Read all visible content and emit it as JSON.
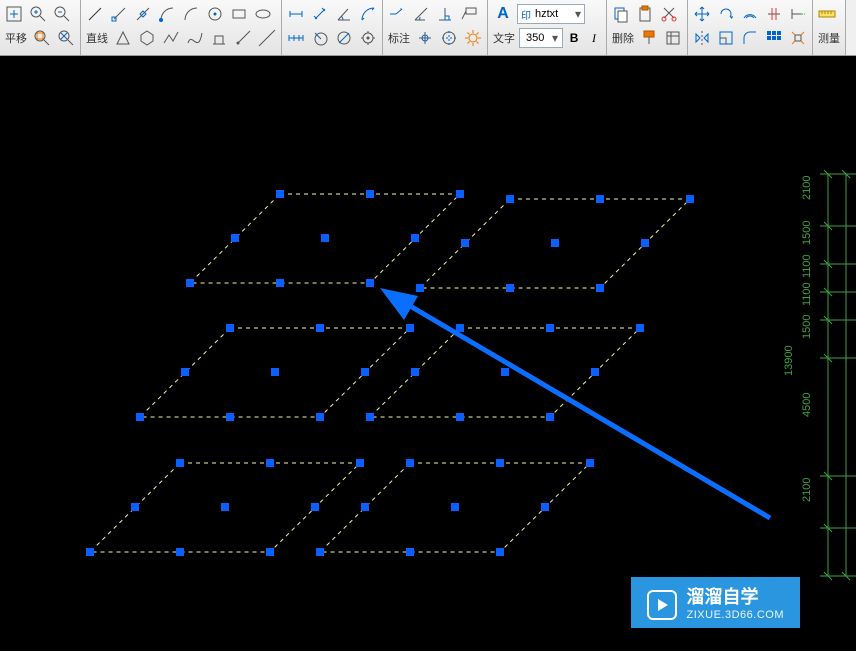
{
  "labels": {
    "pan": "平移",
    "line": "直线",
    "dim": "标注",
    "text": "文字",
    "delete": "删除",
    "measure": "测量"
  },
  "font": {
    "name": "hztxt"
  },
  "text_size": "350",
  "ruler": {
    "total": "13900",
    "segments": [
      "2100",
      "1500",
      "1100",
      "1100",
      "1500",
      "4500",
      "2100"
    ]
  },
  "watermark": {
    "title": "溜溜自学",
    "url": "ZIXUE.3D66.COM"
  },
  "colors": {
    "grip": "#0a5fff",
    "dashed": "#f5f5b0",
    "arrow": "#0a6fff",
    "ruler": "#3fa13f"
  },
  "icons": {
    "zoom_in": "zoom-in",
    "zoom_out": "zoom-out",
    "zoom_extents": "zoom-extents",
    "zoom_window": "zoom-window",
    "snap_end": "snap-end",
    "snap_mid": "snap-mid",
    "snap_cen": "snap-center",
    "snap_tan": "snap-tan",
    "arc": "arc",
    "rect": "rect",
    "ellipse": "ellipse",
    "polygon": "polygon",
    "polyline": "polyline",
    "spline": "spline",
    "pedestal": "pedestal",
    "ray": "ray",
    "angle": "angle",
    "dim_lin": "dim-linear",
    "dim_ang": "dim-angular",
    "dim_rad": "dim-radius",
    "dim_dia": "dim-dia",
    "copy": "copy",
    "paste": "paste",
    "cut": "cut",
    "paint": "paint",
    "properties": "properties",
    "move": "move",
    "rotate": "rotate",
    "mirror": "mirror",
    "array": "array",
    "offset": "offset",
    "scale": "scale"
  }
}
